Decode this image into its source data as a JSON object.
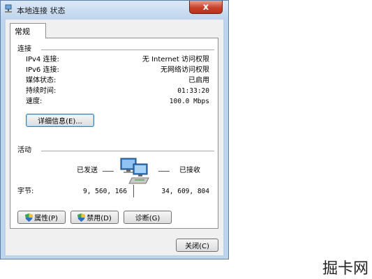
{
  "window": {
    "title": "本地连接 状态",
    "close_glyph": "x",
    "title_icon": "network-connection-icon"
  },
  "tabs": [
    {
      "label": "常规"
    }
  ],
  "connection": {
    "heading": "连接",
    "rows": [
      {
        "label": "IPv4 连接:",
        "value": "无 Internet 访问权限"
      },
      {
        "label": "IPv6 连接:",
        "value": "无网络访问权限"
      },
      {
        "label": "媒体状态:",
        "value": "已启用"
      },
      {
        "label": "持续时间:",
        "value": "01:33:20"
      },
      {
        "label": "速度:",
        "value": "100.0 Mbps"
      }
    ],
    "details_button": "详细信息(E)..."
  },
  "activity": {
    "heading": "活动",
    "sent_label": "已发送",
    "received_label": "已接收",
    "bytes_label": "字节:",
    "bytes_sent": "9, 560, 166",
    "bytes_received": "34, 609, 804",
    "icon": "network-computers-icon"
  },
  "buttons": {
    "properties": "属性(P)",
    "disable": "禁用(D)",
    "diagnose": "诊断(G)",
    "close": "关闭(C)"
  },
  "watermark": "掘卡网"
}
